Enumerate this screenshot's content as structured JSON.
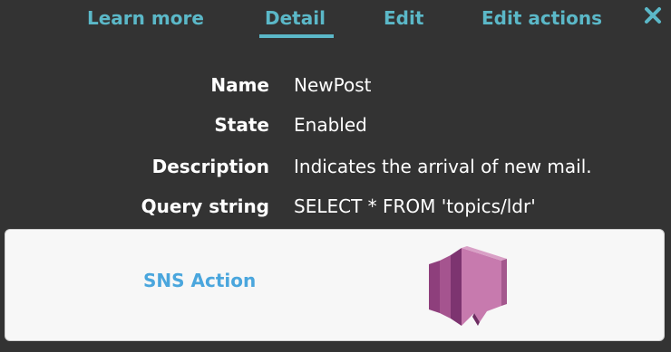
{
  "tabs": {
    "learn_more": "Learn more",
    "detail": "Detail",
    "edit": "Edit",
    "edit_actions": "Edit actions",
    "active": "detail"
  },
  "close_icon": "close-icon",
  "details": {
    "name_label": "Name",
    "name_value": "NewPost",
    "state_label": "State",
    "state_value": "Enabled",
    "description_label": "Description",
    "description_value": "Indicates the arrival of new mail.",
    "query_label": "Query string",
    "query_value": "SELECT * FROM 'topics/ldr'"
  },
  "action": {
    "label": "SNS Action",
    "icon": "sns-icon"
  },
  "colors": {
    "background": "#333333",
    "accent": "#5bb8c8",
    "action_link": "#4aa6dd",
    "card": "#f7f7f7",
    "icon_pink": "#c069a6"
  }
}
